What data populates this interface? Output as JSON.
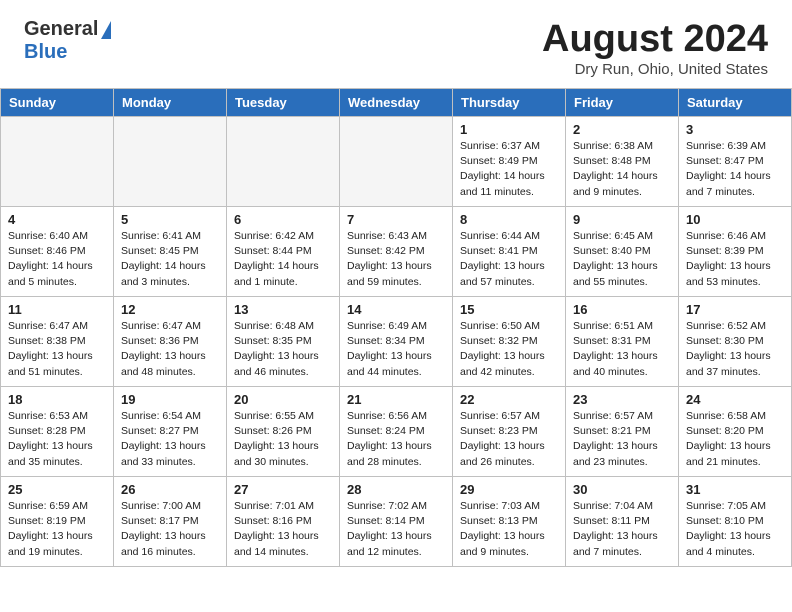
{
  "logo": {
    "general": "General",
    "blue": "Blue"
  },
  "title": "August 2024",
  "location": "Dry Run, Ohio, United States",
  "headers": [
    "Sunday",
    "Monday",
    "Tuesday",
    "Wednesday",
    "Thursday",
    "Friday",
    "Saturday"
  ],
  "weeks": [
    [
      {
        "day": "",
        "info": ""
      },
      {
        "day": "",
        "info": ""
      },
      {
        "day": "",
        "info": ""
      },
      {
        "day": "",
        "info": ""
      },
      {
        "day": "1",
        "info": "Sunrise: 6:37 AM\nSunset: 8:49 PM\nDaylight: 14 hours\nand 11 minutes."
      },
      {
        "day": "2",
        "info": "Sunrise: 6:38 AM\nSunset: 8:48 PM\nDaylight: 14 hours\nand 9 minutes."
      },
      {
        "day": "3",
        "info": "Sunrise: 6:39 AM\nSunset: 8:47 PM\nDaylight: 14 hours\nand 7 minutes."
      }
    ],
    [
      {
        "day": "4",
        "info": "Sunrise: 6:40 AM\nSunset: 8:46 PM\nDaylight: 14 hours\nand 5 minutes."
      },
      {
        "day": "5",
        "info": "Sunrise: 6:41 AM\nSunset: 8:45 PM\nDaylight: 14 hours\nand 3 minutes."
      },
      {
        "day": "6",
        "info": "Sunrise: 6:42 AM\nSunset: 8:44 PM\nDaylight: 14 hours\nand 1 minute."
      },
      {
        "day": "7",
        "info": "Sunrise: 6:43 AM\nSunset: 8:42 PM\nDaylight: 13 hours\nand 59 minutes."
      },
      {
        "day": "8",
        "info": "Sunrise: 6:44 AM\nSunset: 8:41 PM\nDaylight: 13 hours\nand 57 minutes."
      },
      {
        "day": "9",
        "info": "Sunrise: 6:45 AM\nSunset: 8:40 PM\nDaylight: 13 hours\nand 55 minutes."
      },
      {
        "day": "10",
        "info": "Sunrise: 6:46 AM\nSunset: 8:39 PM\nDaylight: 13 hours\nand 53 minutes."
      }
    ],
    [
      {
        "day": "11",
        "info": "Sunrise: 6:47 AM\nSunset: 8:38 PM\nDaylight: 13 hours\nand 51 minutes."
      },
      {
        "day": "12",
        "info": "Sunrise: 6:47 AM\nSunset: 8:36 PM\nDaylight: 13 hours\nand 48 minutes."
      },
      {
        "day": "13",
        "info": "Sunrise: 6:48 AM\nSunset: 8:35 PM\nDaylight: 13 hours\nand 46 minutes."
      },
      {
        "day": "14",
        "info": "Sunrise: 6:49 AM\nSunset: 8:34 PM\nDaylight: 13 hours\nand 44 minutes."
      },
      {
        "day": "15",
        "info": "Sunrise: 6:50 AM\nSunset: 8:32 PM\nDaylight: 13 hours\nand 42 minutes."
      },
      {
        "day": "16",
        "info": "Sunrise: 6:51 AM\nSunset: 8:31 PM\nDaylight: 13 hours\nand 40 minutes."
      },
      {
        "day": "17",
        "info": "Sunrise: 6:52 AM\nSunset: 8:30 PM\nDaylight: 13 hours\nand 37 minutes."
      }
    ],
    [
      {
        "day": "18",
        "info": "Sunrise: 6:53 AM\nSunset: 8:28 PM\nDaylight: 13 hours\nand 35 minutes."
      },
      {
        "day": "19",
        "info": "Sunrise: 6:54 AM\nSunset: 8:27 PM\nDaylight: 13 hours\nand 33 minutes."
      },
      {
        "day": "20",
        "info": "Sunrise: 6:55 AM\nSunset: 8:26 PM\nDaylight: 13 hours\nand 30 minutes."
      },
      {
        "day": "21",
        "info": "Sunrise: 6:56 AM\nSunset: 8:24 PM\nDaylight: 13 hours\nand 28 minutes."
      },
      {
        "day": "22",
        "info": "Sunrise: 6:57 AM\nSunset: 8:23 PM\nDaylight: 13 hours\nand 26 minutes."
      },
      {
        "day": "23",
        "info": "Sunrise: 6:57 AM\nSunset: 8:21 PM\nDaylight: 13 hours\nand 23 minutes."
      },
      {
        "day": "24",
        "info": "Sunrise: 6:58 AM\nSunset: 8:20 PM\nDaylight: 13 hours\nand 21 minutes."
      }
    ],
    [
      {
        "day": "25",
        "info": "Sunrise: 6:59 AM\nSunset: 8:19 PM\nDaylight: 13 hours\nand 19 minutes."
      },
      {
        "day": "26",
        "info": "Sunrise: 7:00 AM\nSunset: 8:17 PM\nDaylight: 13 hours\nand 16 minutes."
      },
      {
        "day": "27",
        "info": "Sunrise: 7:01 AM\nSunset: 8:16 PM\nDaylight: 13 hours\nand 14 minutes."
      },
      {
        "day": "28",
        "info": "Sunrise: 7:02 AM\nSunset: 8:14 PM\nDaylight: 13 hours\nand 12 minutes."
      },
      {
        "day": "29",
        "info": "Sunrise: 7:03 AM\nSunset: 8:13 PM\nDaylight: 13 hours\nand 9 minutes."
      },
      {
        "day": "30",
        "info": "Sunrise: 7:04 AM\nSunset: 8:11 PM\nDaylight: 13 hours\nand 7 minutes."
      },
      {
        "day": "31",
        "info": "Sunrise: 7:05 AM\nSunset: 8:10 PM\nDaylight: 13 hours\nand 4 minutes."
      }
    ]
  ]
}
